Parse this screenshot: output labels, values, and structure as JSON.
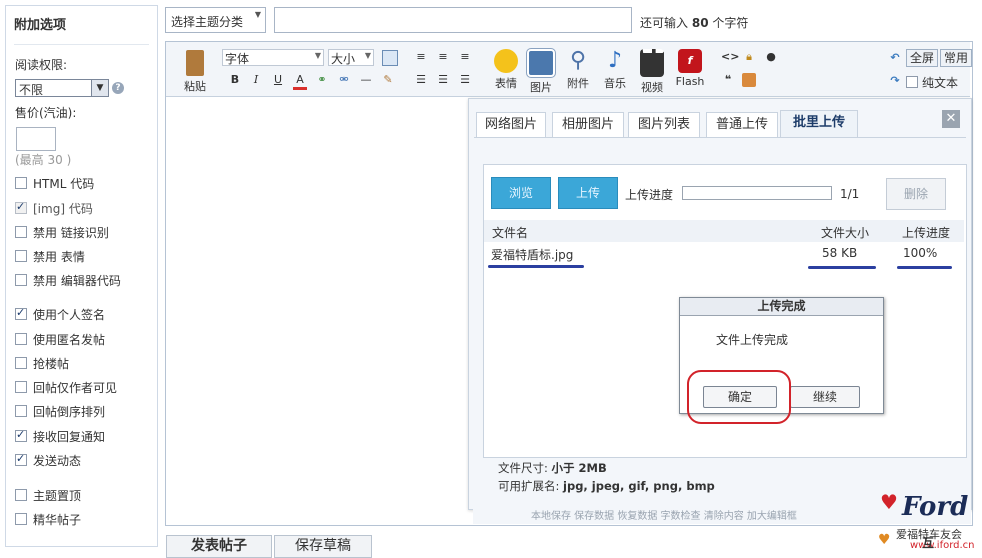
{
  "sidebar": {
    "title": "附加选项",
    "read_label": "阅读权限:",
    "read_value": "不限",
    "price_label": "售价(汽油):",
    "max_hint": "(最高 30 )",
    "options": [
      {
        "label": "HTML 代码",
        "checked": false,
        "disabled": false
      },
      {
        "label": "[img] 代码",
        "checked": true,
        "disabled": true
      },
      {
        "label": "禁用 链接识别",
        "checked": false,
        "disabled": false
      },
      {
        "label": "禁用 表情",
        "checked": false,
        "disabled": false
      },
      {
        "label": "禁用 编辑器代码",
        "checked": false,
        "disabled": false
      },
      {
        "label": "使用个人签名",
        "checked": true,
        "disabled": false
      },
      {
        "label": "使用匿名发帖",
        "checked": false,
        "disabled": false
      },
      {
        "label": "抢楼帖",
        "checked": false,
        "disabled": false
      },
      {
        "label": "回帖仅作者可见",
        "checked": false,
        "disabled": false
      },
      {
        "label": "回帖倒序排列",
        "checked": false,
        "disabled": false
      },
      {
        "label": "接收回复通知",
        "checked": true,
        "disabled": false
      },
      {
        "label": "发送动态",
        "checked": true,
        "disabled": false
      },
      {
        "label": "主题置顶",
        "checked": false,
        "disabled": false
      },
      {
        "label": "精华帖子",
        "checked": false,
        "disabled": false
      }
    ]
  },
  "topbar": {
    "category": "选择主题分类",
    "remain_prefix": "还可输入",
    "remain_count": "80",
    "remain_suffix": "个字符"
  },
  "toolbar": {
    "paste": "粘贴",
    "font": "字体",
    "size": "大小",
    "emoji": "表情",
    "image": "图片",
    "attach": "附件",
    "music": "音乐",
    "video": "视频",
    "flash": "Flash",
    "fullscreen": "全屏",
    "common": "常用",
    "plaintext": "纯文本",
    "fmt_bold": "B",
    "fmt_italic": "I",
    "fmt_underline": "U",
    "fmt_color": "A",
    "code_icon": "<>",
    "quote_icon": "❝"
  },
  "upload": {
    "tabs": [
      "网络图片",
      "相册图片",
      "图片列表",
      "普通上传",
      "批里上传"
    ],
    "browse": "浏览",
    "upload": "上传",
    "progress_label": "上传进度",
    "progress_count": "1/1",
    "delete": "删除",
    "col_name": "文件名",
    "col_size": "文件大小",
    "col_progress": "上传进度",
    "file_name": "爱福特盾标.jpg",
    "file_size": "58 KB",
    "file_progress": "100%",
    "size_label": "文件尺寸:",
    "size_value": "小于 2MB",
    "ext_label": "可用扩展名:",
    "ext_value": "jpg, jpeg, gif, png, bmp",
    "bottom_note": "本地保存  保存数据  恢复数据  字数检查  清除内容  加大编辑框"
  },
  "dialog": {
    "title": "上传完成",
    "message": "文件上传完成",
    "ok": "确定",
    "continue": "继续"
  },
  "footer": {
    "submit": "发表帖子",
    "draft": "保存草稿"
  },
  "watermark": {
    "brand": "Ford",
    "club": "爱福特车友会",
    "url": "www.iford.cn",
    "reply": "互"
  },
  "colors": {
    "accent_blue": "#3ba7d8",
    "annotation_red": "#d2232a",
    "underline_blue": "#2b3fa0"
  }
}
